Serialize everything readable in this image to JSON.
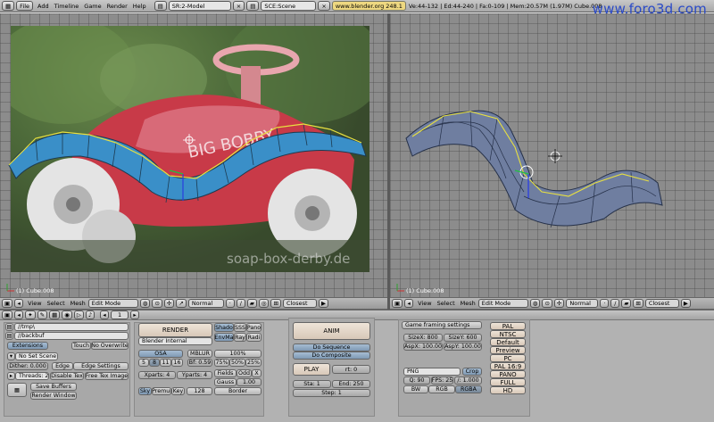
{
  "topbar": {
    "file_label": "File",
    "menus": [
      "Add",
      "Timeline",
      "Game",
      "Render",
      "Help"
    ],
    "screen_field": "SR:2-Model",
    "scene_field": "SCE:Scene",
    "url": "www.blender.org 248.1",
    "stats": "Ve:44-132 | Ed:44-240 | Fa:0-109 | Mem:20.57M (1.97M) Cube.008",
    "watermark": "www.foro3d.com"
  },
  "viewport_left": {
    "caption": "soap-box-derby.de",
    "status": "(1) Cube.008"
  },
  "viewport_right": {
    "status": "(1) Cube.008"
  },
  "header_left": {
    "menus": [
      "View",
      "Select",
      "Mesh"
    ],
    "mode": "Edit Mode",
    "shading": "Normal",
    "snap": "Closest"
  },
  "header_right": {
    "menus": [
      "View",
      "Select",
      "Mesh"
    ],
    "mode": "Edit Mode",
    "shading": "Normal",
    "snap": "Closest"
  },
  "buttons": {
    "frame": "1",
    "output": {
      "path1": "//tmp\\",
      "path2": "//backbuf",
      "extensions": "Extensions",
      "touch": "Touch",
      "no_overwrite": "No Overwrite",
      "no_set_scene": "No Set Scene",
      "dither": "Dither: 0.000",
      "edge": "Edge",
      "edge_settings": "Edge Settings",
      "threads": "Threads: 2",
      "disable_tex": "Disable Tex",
      "free_tex_image": "Free Tex Image",
      "save_buffers": "Save Buffers",
      "render_window": "Render Window"
    },
    "render": {
      "render_label": "RENDER",
      "engine": "Blender Internal",
      "shadow": "Shado",
      "sss": "SSS",
      "pano": "Pano",
      "envmap": "EnvMa",
      "ray": "Ray",
      "radio": "Radi",
      "osa": "OSA",
      "mblur": "MBLUR",
      "osa_levels": [
        "5",
        "8",
        "11",
        "16"
      ],
      "bf": "Bf: 0.59",
      "percent": "100%",
      "percents": [
        "75%",
        "50%",
        "25%"
      ],
      "xparts": "Xparts: 4",
      "yparts": "Yparts: 4",
      "fields": "Fields",
      "odd": "Odd",
      "x": "X",
      "gauss": "Gauss",
      "gauss_val": "1.00",
      "sky": "Sky",
      "premul": "Premul",
      "key": "Key",
      "num128": "128",
      "border": "Border"
    },
    "anim": {
      "anim_label": "ANIM",
      "do_sequence": "Do Sequence",
      "do_composite": "Do Composite",
      "play": "PLAY",
      "rt": "rt: 0",
      "sta": "Sta: 1",
      "end": "End: 250",
      "step": "Step: 1"
    },
    "format": {
      "game_settings": "Game framing settings",
      "sizex": "SizeX: 800",
      "sizey": "SizeY: 600",
      "aspx": "AspX: 100.00",
      "aspy": "AspY: 100.00",
      "png": "PNG",
      "crop": "Crop",
      "quality": "Q: 90",
      "fps": "FPS: 25",
      "fps_base": "/: 1.000",
      "bw": "BW",
      "rgb": "RGB",
      "rgba": "RGBA"
    },
    "presets": [
      "PAL",
      "NTSC",
      "Default",
      "Preview",
      "PC",
      "PAL 16:9",
      "PANO",
      "FULL",
      "HD"
    ]
  }
}
